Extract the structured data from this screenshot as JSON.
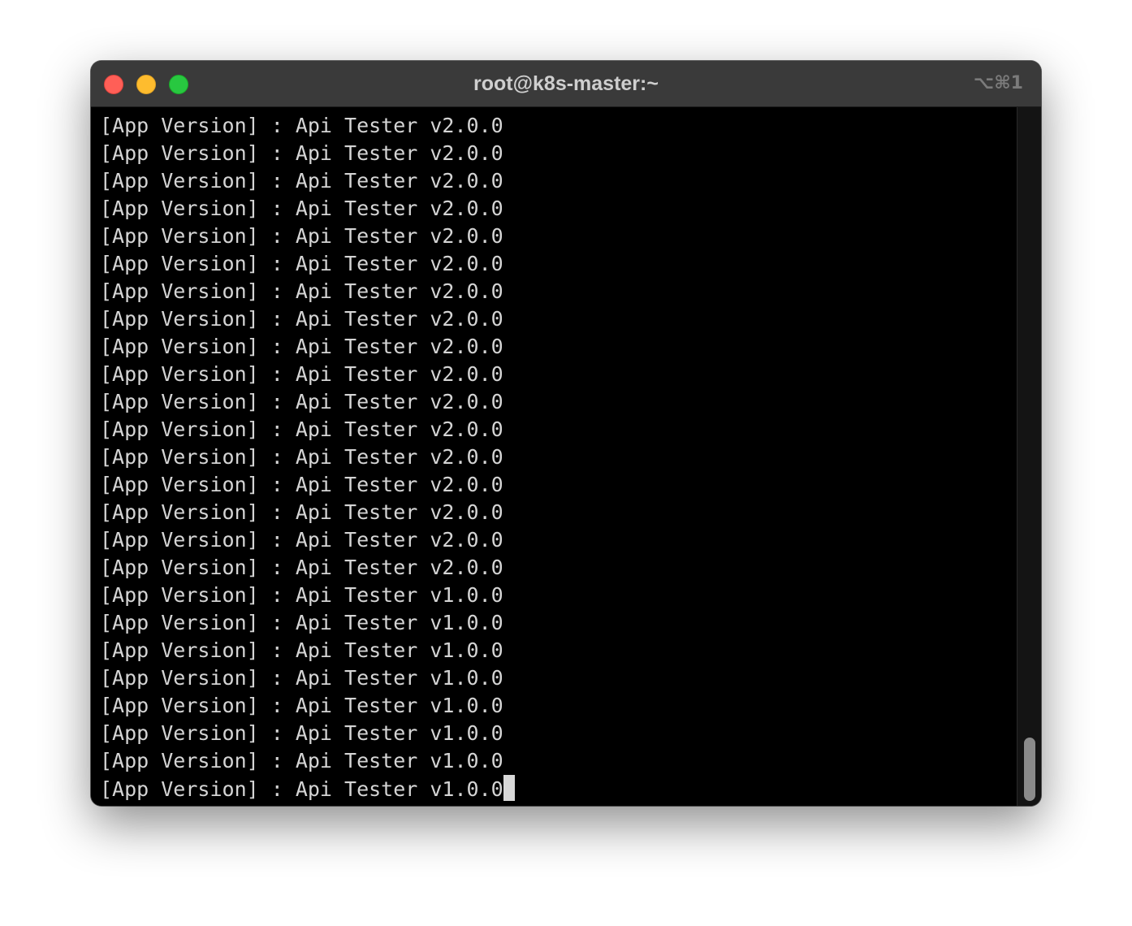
{
  "window": {
    "title": "root@k8s-master:~",
    "shortcut": "⌥⌘1"
  },
  "terminal": {
    "lines": [
      "[App Version] : Api Tester v2.0.0",
      "[App Version] : Api Tester v2.0.0",
      "[App Version] : Api Tester v2.0.0",
      "[App Version] : Api Tester v2.0.0",
      "[App Version] : Api Tester v2.0.0",
      "[App Version] : Api Tester v2.0.0",
      "[App Version] : Api Tester v2.0.0",
      "[App Version] : Api Tester v2.0.0",
      "[App Version] : Api Tester v2.0.0",
      "[App Version] : Api Tester v2.0.0",
      "[App Version] : Api Tester v2.0.0",
      "[App Version] : Api Tester v2.0.0",
      "[App Version] : Api Tester v2.0.0",
      "[App Version] : Api Tester v2.0.0",
      "[App Version] : Api Tester v2.0.0",
      "[App Version] : Api Tester v2.0.0",
      "[App Version] : Api Tester v2.0.0",
      "[App Version] : Api Tester v1.0.0",
      "[App Version] : Api Tester v1.0.0",
      "[App Version] : Api Tester v1.0.0",
      "[App Version] : Api Tester v1.0.0",
      "[App Version] : Api Tester v1.0.0",
      "[App Version] : Api Tester v1.0.0",
      "[App Version] : Api Tester v1.0.0",
      "[App Version] : Api Tester v1.0.0"
    ]
  },
  "colors": {
    "close": "#ff5f57",
    "minimize": "#febc2e",
    "zoom": "#28c840",
    "terminal_bg": "#000000",
    "text": "#d4d4d4"
  }
}
